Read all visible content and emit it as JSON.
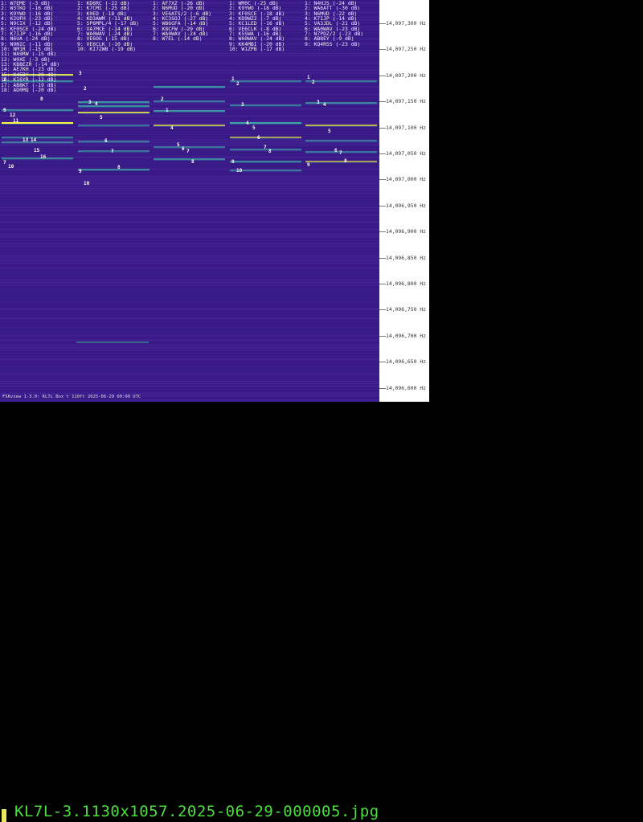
{
  "columns": [
    {
      "entries": [
        "1: W7EME (-3 dB)",
        "2: W3TKO (-16 dB)",
        "3: K9YWO (-16 dB)",
        "4: K2UFH (-23 dB)",
        "5: N9CIX (-12 dB)",
        "6: KF0SCE (-24 dB)",
        "7: K7IJP (-16 dB)",
        "8: N6UA (-24 dB)",
        "9: N9NIC (-11 dB)",
        "10: NM1R (-15 dB)",
        "11: WA9RW (-15 dB)",
        "12: W0XE (-3 dB)",
        "13: KB8EZR (-14 dB)",
        "14: AE7KH (-23 dB)",
        "15: K4EBY (-29 dB)",
        "16: KI6YR (-12 dB)",
        "17: AB8KT (-19 dB)",
        "18: AD0MQ (-20 dB)"
      ]
    },
    {
      "entries": [
        "1: KD6RC (-22 dB)",
        "2: K7CMI (-25 dB)",
        "3: K0ED (-18 dB)",
        "4: KD3AWM (-11 dB)",
        "5: SP6MPL/4 (-17 dB)",
        "6: VA7MCE (-14 dB)",
        "7: WA0WAV (-24 dB)",
        "8: VE6OG (-15 dB)",
        "9: VE6CLK (-10 dB)",
        "10: KI7ZWB (-19 dB)"
      ]
    },
    {
      "entries": [
        "1: AF7XZ (-26 dB)",
        "2: N6MUD (-20 dB)",
        "3: VE6ATS/2 (-6 dB)",
        "4: KC3SOJ (-27 dB)",
        "5: WB6GFA (-14 dB)",
        "6: K8CFW (-29 dB)",
        "7: WA0WAV (-24 dB)",
        "8: W7EL (-14 dB)"
      ]
    },
    {
      "entries": [
        "1: WM0C (-25 dB)",
        "2: K9YWO (-18 dB)",
        "3: KF0SCE (-18 dB)",
        "4: KD9WZ2 (-7 dB)",
        "5: KC1LED (-16 dB)",
        "6: VE6CLK (-8 dB)",
        "7: K5SWA (-16 dB)",
        "8: WA0WAV (-24 dB)",
        "9: KK4MBI (-20 dB)",
        "10: W1ZPB (-17 dB)"
      ]
    },
    {
      "entries": [
        "1: N4HJS (-24 dB)",
        "2: WA6ATT (-30 dB)",
        "3: N6MUD (-22 dB)",
        "4: K7IJP (-14 dB)",
        "5: VA3JDL (-21 dB)",
        "6: WA0WAV (-23 dB)",
        "7: N7PDZ/2 (-23 dB)",
        "8: AB8EY (-9 dB)",
        "9: KQ4RSS (-23 dB)"
      ]
    }
  ],
  "signal_labels": [
    {
      "text": "3",
      "col": 0
    },
    {
      "text": "2",
      "col": 0
    },
    {
      "text": "8",
      "col": 0
    },
    {
      "text": "9",
      "col": 0
    },
    {
      "text": "12",
      "col": 0
    },
    {
      "text": "11",
      "col": 0
    },
    {
      "text": "13",
      "col": 0
    },
    {
      "text": "14",
      "col": 0
    },
    {
      "text": "15",
      "col": 0
    },
    {
      "text": "16",
      "col": 0
    },
    {
      "text": "7",
      "col": 0
    },
    {
      "text": "10",
      "col": 0
    },
    {
      "text": "2",
      "col": 1
    },
    {
      "text": "3",
      "col": 1
    },
    {
      "text": "4",
      "col": 1
    },
    {
      "text": "5",
      "col": 1
    },
    {
      "text": "6",
      "col": 1
    },
    {
      "text": "7",
      "col": 1
    },
    {
      "text": "8",
      "col": 1
    },
    {
      "text": "9",
      "col": 1
    },
    {
      "text": "10",
      "col": 1
    },
    {
      "text": "2",
      "col": 2
    },
    {
      "text": "1",
      "col": 2
    },
    {
      "text": "4",
      "col": 2
    },
    {
      "text": "5",
      "col": 2
    },
    {
      "text": "6",
      "col": 2
    },
    {
      "text": "7",
      "col": 2
    },
    {
      "text": "8",
      "col": 2
    },
    {
      "text": "1",
      "col": 3
    },
    {
      "text": "2",
      "col": 3
    },
    {
      "text": "3",
      "col": 3
    },
    {
      "text": "4",
      "col": 3
    },
    {
      "text": "5",
      "col": 3
    },
    {
      "text": "6",
      "col": 3
    },
    {
      "text": "7",
      "col": 3
    },
    {
      "text": "8",
      "col": 3
    },
    {
      "text": "9",
      "col": 3
    },
    {
      "text": "10",
      "col": 3
    },
    {
      "text": "1",
      "col": 4
    },
    {
      "text": "2",
      "col": 4
    },
    {
      "text": "3",
      "col": 4
    },
    {
      "text": "4",
      "col": 4
    },
    {
      "text": "5",
      "col": 4
    },
    {
      "text": "6",
      "col": 4
    },
    {
      "text": "7",
      "col": 4
    },
    {
      "text": "8",
      "col": 4
    },
    {
      "text": "9",
      "col": 4
    }
  ],
  "frequency_axis": {
    "labels": [
      "14,097,300 Hz",
      "14,097,250 Hz",
      "14,097,200 Hz",
      "14,097,150 Hz",
      "14,097,100 Hz",
      "14,097,050 Hz",
      "14,097,000 Hz",
      "14,096,950 Hz",
      "14,096,900 Hz",
      "14,096,850 Hz",
      "14,096,800 Hz",
      "14,096,750 Hz",
      "14,096,700 Hz",
      "14,096,650 Hz",
      "14,096,600 Hz"
    ]
  },
  "footer_text": "FSKview 1.3.0: KL7L Box t 110ft 2025-06-29 00:00 UTC",
  "filename": "KL7L-3.1130x1057.2025-06-29-000005.jpg",
  "colors": {
    "waterfall_bg": "#3b1c8a",
    "signal_yellow": "#f5f542",
    "signal_cyan": "#3fb0a8",
    "filename_green": "#4ede40"
  }
}
